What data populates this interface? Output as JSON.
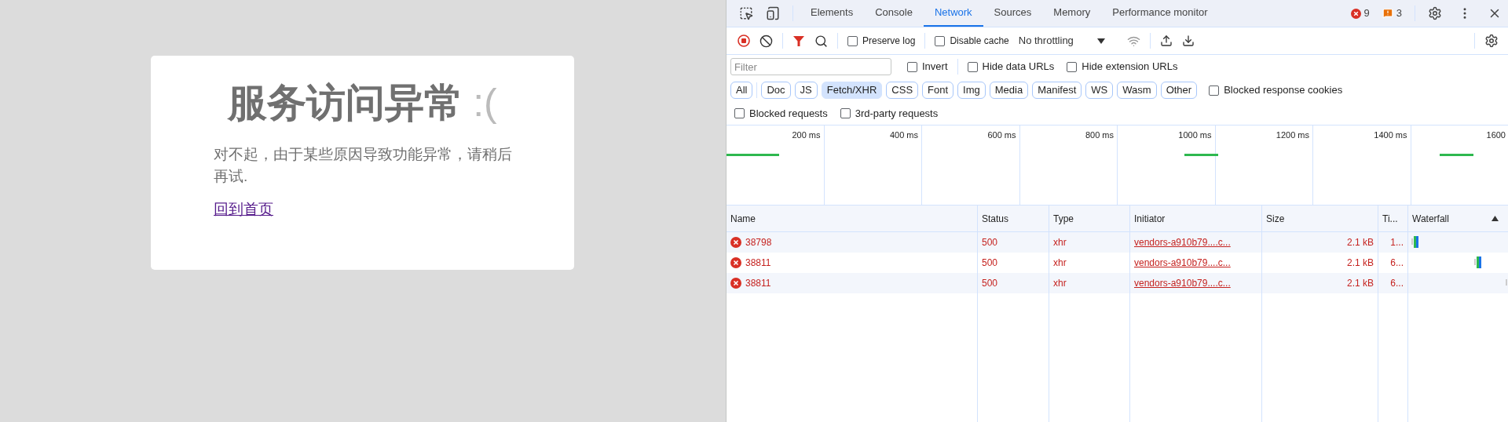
{
  "page": {
    "title": "服务访问异常",
    "emoticon": ":(",
    "message": "对不起，由于某些原因导致功能异常，请稍后再试.",
    "link": "回到首页"
  },
  "devtools": {
    "tabs": [
      {
        "label": "Elements",
        "selected": false
      },
      {
        "label": "Console",
        "selected": false
      },
      {
        "label": "Network",
        "selected": true
      },
      {
        "label": "Sources",
        "selected": false
      },
      {
        "label": "Memory",
        "selected": false
      },
      {
        "label": "Performance monitor",
        "selected": false
      }
    ],
    "error_count": "9",
    "issue_count": "3",
    "toolbar": {
      "recording": true,
      "preserve_log": {
        "label": "Preserve log",
        "checked": false
      },
      "disable_cache": {
        "label": "Disable cache",
        "checked": false
      },
      "throttling": "No throttling"
    },
    "filter": {
      "placeholder": "Filter",
      "options": [
        {
          "label": "Invert",
          "checked": false
        },
        {
          "label": "Hide data URLs",
          "checked": false
        },
        {
          "label": "Hide extension URLs",
          "checked": false
        }
      ]
    },
    "types": [
      {
        "label": "All",
        "selected": false
      },
      {
        "label": "Doc",
        "selected": false
      },
      {
        "label": "JS",
        "selected": false
      },
      {
        "label": "Fetch/XHR",
        "selected": true
      },
      {
        "label": "CSS",
        "selected": false
      },
      {
        "label": "Font",
        "selected": false
      },
      {
        "label": "Img",
        "selected": false
      },
      {
        "label": "Media",
        "selected": false
      },
      {
        "label": "Manifest",
        "selected": false
      },
      {
        "label": "WS",
        "selected": false
      },
      {
        "label": "Wasm",
        "selected": false
      },
      {
        "label": "Other",
        "selected": false
      }
    ],
    "more_options": [
      {
        "label": "Blocked response cookies",
        "checked": false
      },
      {
        "label": "Blocked requests",
        "checked": false
      },
      {
        "label": "3rd-party requests",
        "checked": false
      }
    ],
    "timeline_ticks": [
      "200 ms",
      "400 ms",
      "600 ms",
      "800 ms",
      "1000 ms",
      "1200 ms",
      "1400 ms",
      "1600"
    ],
    "table": {
      "columns": [
        "Name",
        "Status",
        "Type",
        "Initiator",
        "Size",
        "Ti...",
        "Waterfall"
      ],
      "rows": [
        {
          "error": true,
          "name": "38798",
          "status": "500",
          "type": "xhr",
          "initiator": "vendors-a910b79....c...",
          "size": "2.1 kB",
          "time": "1..."
        },
        {
          "error": true,
          "name": "38811",
          "status": "500",
          "type": "xhr",
          "initiator": "vendors-a910b79....c...",
          "size": "2.1 kB",
          "time": "6..."
        },
        {
          "error": true,
          "name": "38811",
          "status": "500",
          "type": "xhr",
          "initiator": "vendors-a910b79....c...",
          "size": "2.1 kB",
          "time": "6..."
        }
      ]
    }
  }
}
